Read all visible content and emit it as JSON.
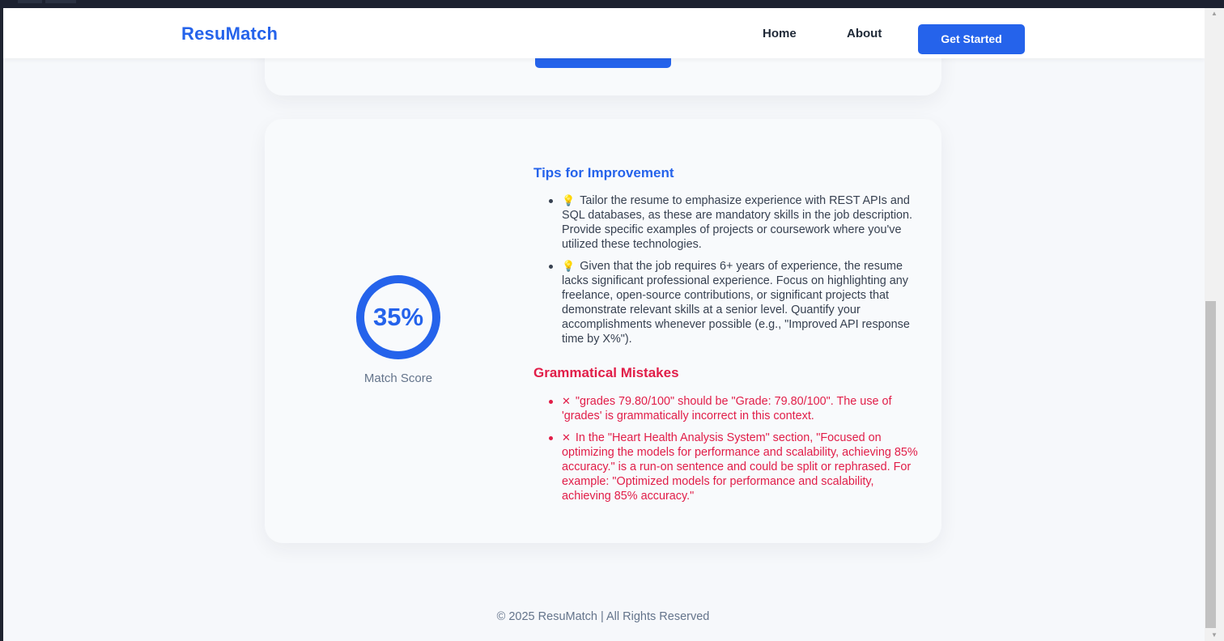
{
  "navbar": {
    "brand": "ResuMatch",
    "links": [
      "Home",
      "About"
    ],
    "cta_label": "Get Started"
  },
  "score": {
    "value": "35%",
    "fraction": 0.35,
    "label": "Match Score"
  },
  "tips": {
    "title": "Tips for Improvement",
    "icon": "lightbulb-icon",
    "items": [
      "Tailor the resume to emphasize experience with REST APIs and SQL databases, as these are mandatory skills in the job description. Provide specific examples of projects or coursework where you've utilized these technologies.",
      "Given that the job requires 6+ years of experience, the resume lacks significant professional experience. Focus on highlighting any freelance, open-source contributions, or significant projects that demonstrate relevant skills at a senior level. Quantify your accomplishments whenever possible (e.g., \"Improved API response time by X%\")."
    ]
  },
  "grammar": {
    "title": "Grammatical Mistakes",
    "icon": "cross-mark-icon",
    "items": [
      "\"grades 79.80/100\" should be \"Grade: 79.80/100\". The use of 'grades' is grammatically incorrect in this context.",
      "In the \"Heart Health Analysis System\" section, \"Focused on optimizing the models for performance and scalability, achieving 85% accuracy.\" is a run-on sentence and could be split or rephrased. For example: \"Optimized models for performance and scalability, achieving 85% accuracy.\""
    ]
  },
  "footer": {
    "text": "© 2025 ResuMatch | All Rights Reserved"
  },
  "colors": {
    "accent": "#2563eb",
    "error": "#e11d48",
    "background": "#f6f8fb"
  }
}
